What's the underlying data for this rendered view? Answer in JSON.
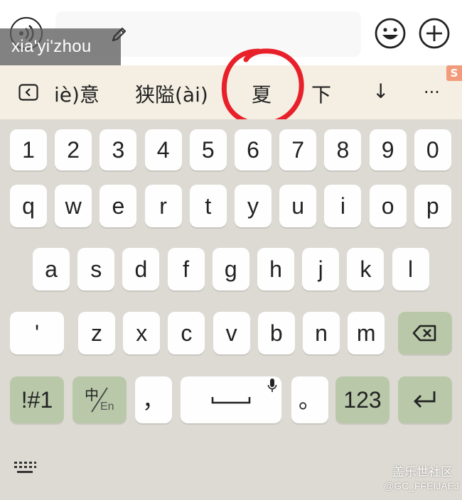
{
  "input": {
    "pinyin": "xia'yi'zhou"
  },
  "icons": {
    "voice": "voice-input-icon",
    "pencil": "edit-pencil-icon",
    "emoji": "emoji-icon",
    "plus": "plus-icon",
    "back": "collapse-candidates-icon",
    "hide_keyboard": "hide-keyboard-icon",
    "backspace": "backspace-icon",
    "enter": "enter-icon",
    "mic": "mic-icon"
  },
  "candidates": {
    "items": [
      "iè)意",
      "狭隘(ài)",
      "夏",
      "下"
    ],
    "expand_label": "↓",
    "more_label": "···",
    "brand_mark": "S"
  },
  "keyboard": {
    "number_row": [
      "1",
      "2",
      "3",
      "4",
      "5",
      "6",
      "7",
      "8",
      "9",
      "0"
    ],
    "row1": [
      "q",
      "w",
      "e",
      "r",
      "t",
      "y",
      "u",
      "i",
      "o",
      "p"
    ],
    "row2": [
      "a",
      "s",
      "d",
      "f",
      "g",
      "h",
      "j",
      "k",
      "l"
    ],
    "row3": [
      "'",
      "z",
      "x",
      "c",
      "v",
      "b",
      "n",
      "m"
    ],
    "symbols_label": "!#1",
    "lang_top": "中",
    "lang_bottom": "En",
    "comma_label": "，",
    "period_label": "。",
    "numeric_label": "123"
  },
  "watermark": {
    "line1": "盖乐世社区",
    "line2": "@GC_FFEIJAEJ"
  },
  "colors": {
    "candidate_bar": "#f5efe3",
    "keyboard_bg": "#dcdad2",
    "function_key": "#b9c8a9",
    "annotation": "#e8202a",
    "brand_badge": "#f29b7a"
  }
}
